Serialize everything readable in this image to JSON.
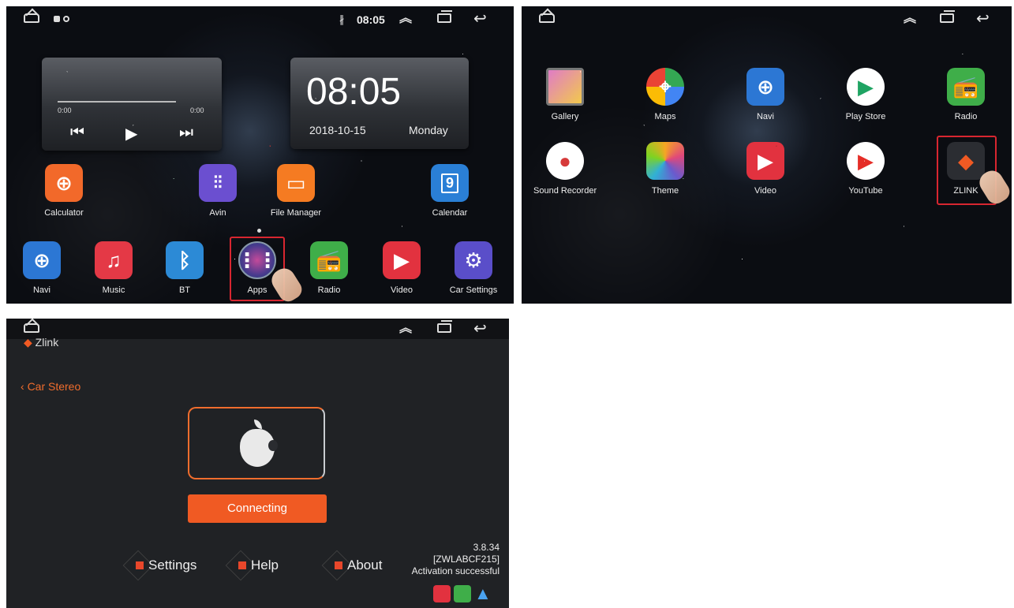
{
  "home": {
    "status_time": "08:05",
    "music": {
      "elapsed": "0:00",
      "total": "0:00"
    },
    "clock": {
      "time": "08:05",
      "date": "2018-10-15",
      "day": "Monday"
    },
    "row1": [
      "Calculator",
      "Avin",
      "File Manager",
      "Calendar"
    ],
    "calendar_day": "9",
    "dock": [
      "Navi",
      "Music",
      "BT",
      "Apps",
      "Radio",
      "Video",
      "Car Settings"
    ]
  },
  "apps": {
    "row1": [
      "Gallery",
      "Maps",
      "Navi",
      "Play Store",
      "Radio"
    ],
    "row2": [
      "Sound Recorder",
      "Theme",
      "Video",
      "YouTube",
      "ZLINK"
    ]
  },
  "zlink": {
    "logo": "Zlink",
    "back": "Car Stereo",
    "connect": "Connecting",
    "buttons": [
      "Settings",
      "Help",
      "About"
    ],
    "version": "3.8.34",
    "device_id": "[ZWLABCF215]",
    "activation": "Activation successful"
  },
  "colors": {
    "accent": "#f05a23",
    "highlight": "#d82630"
  }
}
